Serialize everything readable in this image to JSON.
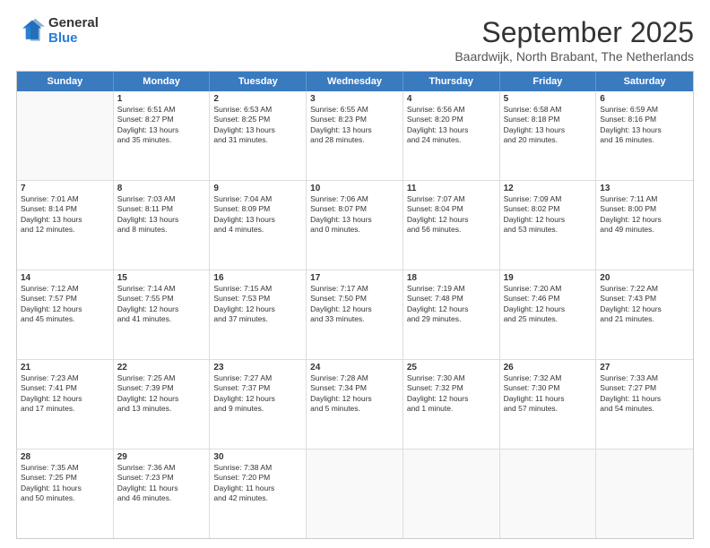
{
  "logo": {
    "general": "General",
    "blue": "Blue"
  },
  "header": {
    "month": "September 2025",
    "location": "Baardwijk, North Brabant, The Netherlands"
  },
  "days": [
    "Sunday",
    "Monday",
    "Tuesday",
    "Wednesday",
    "Thursday",
    "Friday",
    "Saturday"
  ],
  "weeks": [
    [
      {
        "day": "",
        "empty": true
      },
      {
        "day": "1",
        "lines": [
          "Sunrise: 6:51 AM",
          "Sunset: 8:27 PM",
          "Daylight: 13 hours",
          "and 35 minutes."
        ]
      },
      {
        "day": "2",
        "lines": [
          "Sunrise: 6:53 AM",
          "Sunset: 8:25 PM",
          "Daylight: 13 hours",
          "and 31 minutes."
        ]
      },
      {
        "day": "3",
        "lines": [
          "Sunrise: 6:55 AM",
          "Sunset: 8:23 PM",
          "Daylight: 13 hours",
          "and 28 minutes."
        ]
      },
      {
        "day": "4",
        "lines": [
          "Sunrise: 6:56 AM",
          "Sunset: 8:20 PM",
          "Daylight: 13 hours",
          "and 24 minutes."
        ]
      },
      {
        "day": "5",
        "lines": [
          "Sunrise: 6:58 AM",
          "Sunset: 8:18 PM",
          "Daylight: 13 hours",
          "and 20 minutes."
        ]
      },
      {
        "day": "6",
        "lines": [
          "Sunrise: 6:59 AM",
          "Sunset: 8:16 PM",
          "Daylight: 13 hours",
          "and 16 minutes."
        ]
      }
    ],
    [
      {
        "day": "7",
        "lines": [
          "Sunrise: 7:01 AM",
          "Sunset: 8:14 PM",
          "Daylight: 13 hours",
          "and 12 minutes."
        ]
      },
      {
        "day": "8",
        "lines": [
          "Sunrise: 7:03 AM",
          "Sunset: 8:11 PM",
          "Daylight: 13 hours",
          "and 8 minutes."
        ]
      },
      {
        "day": "9",
        "lines": [
          "Sunrise: 7:04 AM",
          "Sunset: 8:09 PM",
          "Daylight: 13 hours",
          "and 4 minutes."
        ]
      },
      {
        "day": "10",
        "lines": [
          "Sunrise: 7:06 AM",
          "Sunset: 8:07 PM",
          "Daylight: 13 hours",
          "and 0 minutes."
        ]
      },
      {
        "day": "11",
        "lines": [
          "Sunrise: 7:07 AM",
          "Sunset: 8:04 PM",
          "Daylight: 12 hours",
          "and 56 minutes."
        ]
      },
      {
        "day": "12",
        "lines": [
          "Sunrise: 7:09 AM",
          "Sunset: 8:02 PM",
          "Daylight: 12 hours",
          "and 53 minutes."
        ]
      },
      {
        "day": "13",
        "lines": [
          "Sunrise: 7:11 AM",
          "Sunset: 8:00 PM",
          "Daylight: 12 hours",
          "and 49 minutes."
        ]
      }
    ],
    [
      {
        "day": "14",
        "lines": [
          "Sunrise: 7:12 AM",
          "Sunset: 7:57 PM",
          "Daylight: 12 hours",
          "and 45 minutes."
        ]
      },
      {
        "day": "15",
        "lines": [
          "Sunrise: 7:14 AM",
          "Sunset: 7:55 PM",
          "Daylight: 12 hours",
          "and 41 minutes."
        ]
      },
      {
        "day": "16",
        "lines": [
          "Sunrise: 7:15 AM",
          "Sunset: 7:53 PM",
          "Daylight: 12 hours",
          "and 37 minutes."
        ]
      },
      {
        "day": "17",
        "lines": [
          "Sunrise: 7:17 AM",
          "Sunset: 7:50 PM",
          "Daylight: 12 hours",
          "and 33 minutes."
        ]
      },
      {
        "day": "18",
        "lines": [
          "Sunrise: 7:19 AM",
          "Sunset: 7:48 PM",
          "Daylight: 12 hours",
          "and 29 minutes."
        ]
      },
      {
        "day": "19",
        "lines": [
          "Sunrise: 7:20 AM",
          "Sunset: 7:46 PM",
          "Daylight: 12 hours",
          "and 25 minutes."
        ]
      },
      {
        "day": "20",
        "lines": [
          "Sunrise: 7:22 AM",
          "Sunset: 7:43 PM",
          "Daylight: 12 hours",
          "and 21 minutes."
        ]
      }
    ],
    [
      {
        "day": "21",
        "lines": [
          "Sunrise: 7:23 AM",
          "Sunset: 7:41 PM",
          "Daylight: 12 hours",
          "and 17 minutes."
        ]
      },
      {
        "day": "22",
        "lines": [
          "Sunrise: 7:25 AM",
          "Sunset: 7:39 PM",
          "Daylight: 12 hours",
          "and 13 minutes."
        ]
      },
      {
        "day": "23",
        "lines": [
          "Sunrise: 7:27 AM",
          "Sunset: 7:37 PM",
          "Daylight: 12 hours",
          "and 9 minutes."
        ]
      },
      {
        "day": "24",
        "lines": [
          "Sunrise: 7:28 AM",
          "Sunset: 7:34 PM",
          "Daylight: 12 hours",
          "and 5 minutes."
        ]
      },
      {
        "day": "25",
        "lines": [
          "Sunrise: 7:30 AM",
          "Sunset: 7:32 PM",
          "Daylight: 12 hours",
          "and 1 minute."
        ]
      },
      {
        "day": "26",
        "lines": [
          "Sunrise: 7:32 AM",
          "Sunset: 7:30 PM",
          "Daylight: 11 hours",
          "and 57 minutes."
        ]
      },
      {
        "day": "27",
        "lines": [
          "Sunrise: 7:33 AM",
          "Sunset: 7:27 PM",
          "Daylight: 11 hours",
          "and 54 minutes."
        ]
      }
    ],
    [
      {
        "day": "28",
        "lines": [
          "Sunrise: 7:35 AM",
          "Sunset: 7:25 PM",
          "Daylight: 11 hours",
          "and 50 minutes."
        ]
      },
      {
        "day": "29",
        "lines": [
          "Sunrise: 7:36 AM",
          "Sunset: 7:23 PM",
          "Daylight: 11 hours",
          "and 46 minutes."
        ]
      },
      {
        "day": "30",
        "lines": [
          "Sunrise: 7:38 AM",
          "Sunset: 7:20 PM",
          "Daylight: 11 hours",
          "and 42 minutes."
        ]
      },
      {
        "day": "",
        "empty": true
      },
      {
        "day": "",
        "empty": true
      },
      {
        "day": "",
        "empty": true
      },
      {
        "day": "",
        "empty": true
      }
    ]
  ]
}
